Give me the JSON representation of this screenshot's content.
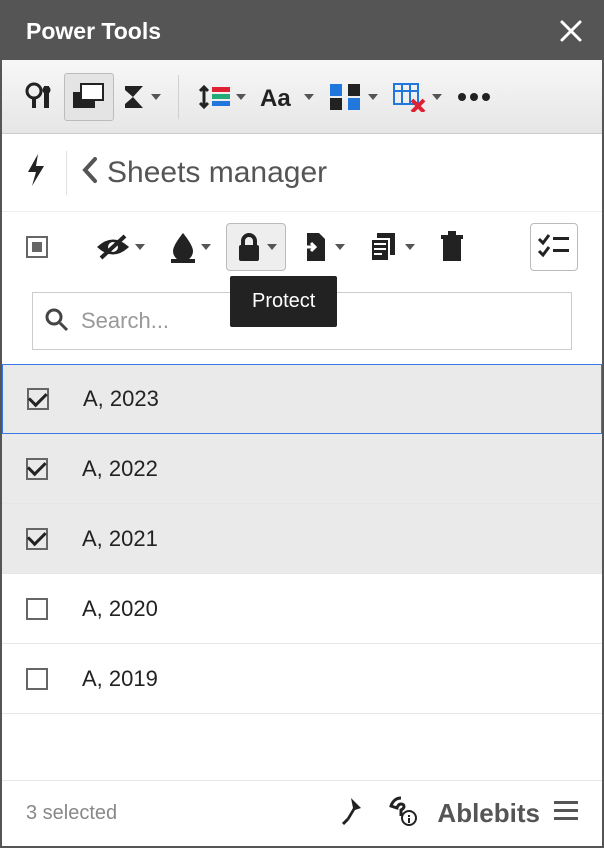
{
  "header": {
    "title": "Power Tools"
  },
  "crumb": {
    "title": "Sheets manager"
  },
  "tooltip": "Protect",
  "search": {
    "placeholder": "Search..."
  },
  "sheets": [
    {
      "name": "A, 2023",
      "checked": true,
      "active": true
    },
    {
      "name": "A, 2022",
      "checked": true,
      "active": false
    },
    {
      "name": "A, 2021",
      "checked": true,
      "active": false
    },
    {
      "name": "A, 2020",
      "checked": false,
      "active": false
    },
    {
      "name": "A, 2019",
      "checked": false,
      "active": false
    }
  ],
  "footer": {
    "selected_text": "3 selected",
    "brand": "Ablebits"
  }
}
